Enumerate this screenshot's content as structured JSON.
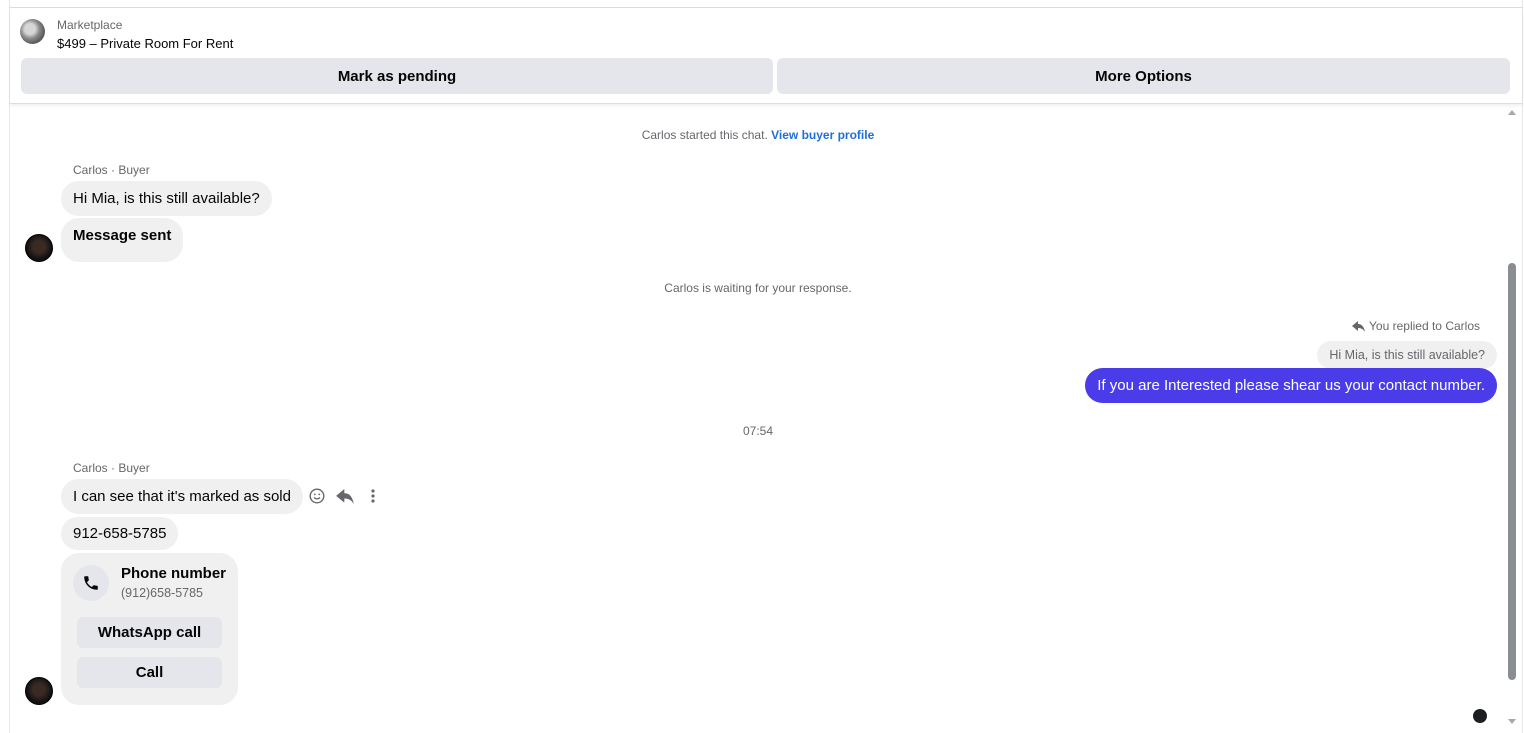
{
  "header": {
    "source": "Marketplace",
    "listing_title": "$499 – Private Room For Rent",
    "pending_button": "Mark as pending",
    "more_button": "More Options"
  },
  "chat": {
    "started_prefix": "Carlos started this chat. ",
    "view_profile_link": "View buyer profile",
    "sender_label_1": "Carlos · Buyer",
    "msg_1": "Hi Mia, is this still available?",
    "msg_2": "Message sent",
    "waiting": "Carlos is waiting for your response.",
    "reply_note": "You replied to Carlos",
    "quoted": "Hi Mia, is this still available?",
    "my_msg": "If you are Interested please shear us your contact number.",
    "time": "07:54",
    "sender_label_2": "Carlos · Buyer",
    "msg_3": "I can see that it's marked as sold",
    "msg_4": "912-658-5785",
    "card": {
      "title": "Phone number",
      "number": "(912)658-5785",
      "whatsapp_button": "WhatsApp call",
      "call_button": "Call"
    }
  },
  "icons": {
    "react": "smile-icon",
    "reply": "reply-icon",
    "more": "more-vertical-icon",
    "phone": "phone-icon"
  },
  "colors": {
    "outgoing_bubble": "#4a3ce8",
    "link": "#216fdb",
    "button_bg": "#e4e6eb",
    "incoming_bubble": "#f0f0f0"
  }
}
